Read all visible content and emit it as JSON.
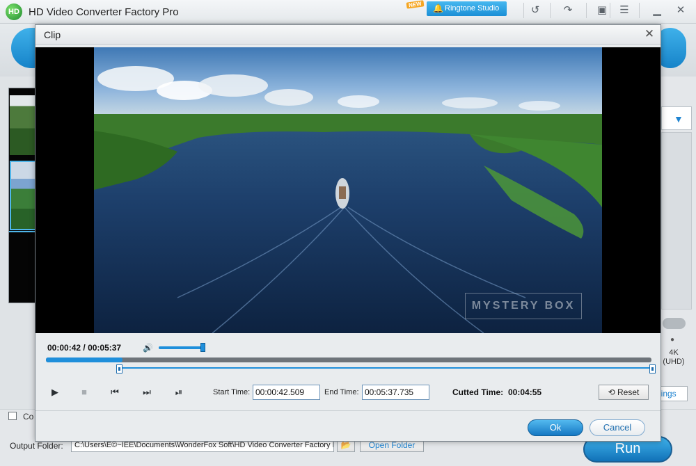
{
  "app": {
    "logo_text": "HD",
    "title": "HD Video Converter Factory Pro",
    "new_badge": "NEW",
    "ringtone_label": "Ringtone Studio"
  },
  "toolbar_icons": [
    "undo-icon",
    "redo-icon",
    "chat-icon",
    "list-icon",
    "minimize-icon",
    "close-icon"
  ],
  "left_panel": {
    "merge_label": "Co"
  },
  "right_panel": {
    "format_label": "4K\n(UHD)",
    "settings_label": "ttings"
  },
  "bottom": {
    "output_label": "Output Folder:",
    "output_path": "C:\\Users\\E©~IEE\\Documents\\WonderFox Soft\\HD Video Converter Factory I",
    "open_folder_label": "Open Folder",
    "run_label": "Run"
  },
  "dialog": {
    "title": "Clip",
    "watermark": "MYSTERY BOX",
    "current_time": "00:00:42",
    "total_time": "00:05:37",
    "volume_level": 0.95,
    "progress_fraction": 0.126,
    "start_time_label": "Start Time:",
    "start_time_value": "00:00:42.509",
    "end_time_label": "End Time:",
    "end_time_value": "00:05:37.735",
    "cutted_label": "Cutted Time:",
    "cutted_value": "00:04:55",
    "reset_label": "Reset",
    "ok_label": "Ok",
    "cancel_label": "Cancel"
  },
  "colors": {
    "accent": "#1f8fdb",
    "run_button": "#1172b8",
    "ringtone_button": "#1b8fd6"
  }
}
